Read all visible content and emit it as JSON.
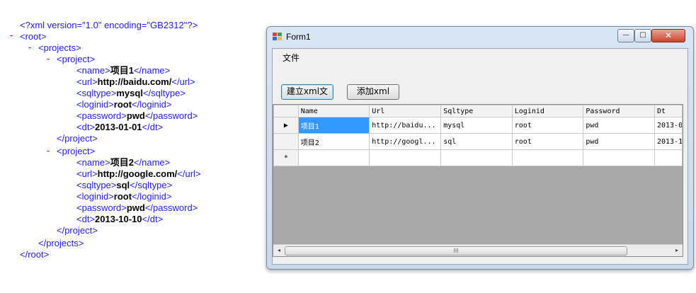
{
  "xml_view": {
    "lines": [
      {
        "text": "<?xml version=\"1.0\" encoding=\"GB2312\"?>"
      },
      {
        "text": "<root>"
      },
      {
        "text": "<projects>"
      },
      {
        "text": "<project>"
      },
      {
        "open": "<name>",
        "value": "项目1",
        "close": "</name>"
      },
      {
        "open": "<url>",
        "value": "http://baidu.com/",
        "close": "</url>"
      },
      {
        "open": "<sqltype>",
        "value": "mysql",
        "close": "</sqltype>"
      },
      {
        "open": "<loginid>",
        "value": "root",
        "close": "</loginid>"
      },
      {
        "open": "<password>",
        "value": "pwd",
        "close": "</password>"
      },
      {
        "open": "<dt>",
        "value": "2013-01-01",
        "close": "</dt>"
      },
      {
        "text": "</project>"
      },
      {
        "text": "<project>"
      },
      {
        "open": "<name>",
        "value": "项目2",
        "close": "</name>"
      },
      {
        "open": "<url>",
        "value": "http://google.com/",
        "close": "</url>"
      },
      {
        "open": "<sqltype>",
        "value": "sql",
        "close": "</sqltype>"
      },
      {
        "open": "<loginid>",
        "value": "root",
        "close": "</loginid>"
      },
      {
        "open": "<password>",
        "value": "pwd",
        "close": "</password>"
      },
      {
        "open": "<dt>",
        "value": "2013-10-10",
        "close": "</dt>"
      },
      {
        "text": "</project>"
      },
      {
        "text": "</projects>"
      },
      {
        "text": "</root>"
      }
    ],
    "minus": "-"
  },
  "window": {
    "title": "Form1",
    "min_glyph": "—",
    "max_glyph": "□",
    "close_glyph": "✕",
    "menu": {
      "file_label": "文件"
    },
    "buttons": {
      "create_xml_label": "建立xml文",
      "add_xml_label": "添加xml"
    },
    "grid": {
      "columns": [
        "Name",
        "Url",
        "Sqltype",
        "Loginid",
        "Password",
        "Dt"
      ],
      "rows": [
        [
          "项目1",
          "http://baidu...",
          "mysql",
          "root",
          "pwd",
          "2013-0"
        ],
        [
          "项目2",
          "http://googl...",
          "sql",
          "root",
          "pwd",
          "2013-1"
        ]
      ],
      "current_row_marker": "▶",
      "new_row_marker": "*",
      "scroll_left_glyph": "◂",
      "scroll_right_glyph": "▸",
      "thumb_grip": "III"
    }
  }
}
